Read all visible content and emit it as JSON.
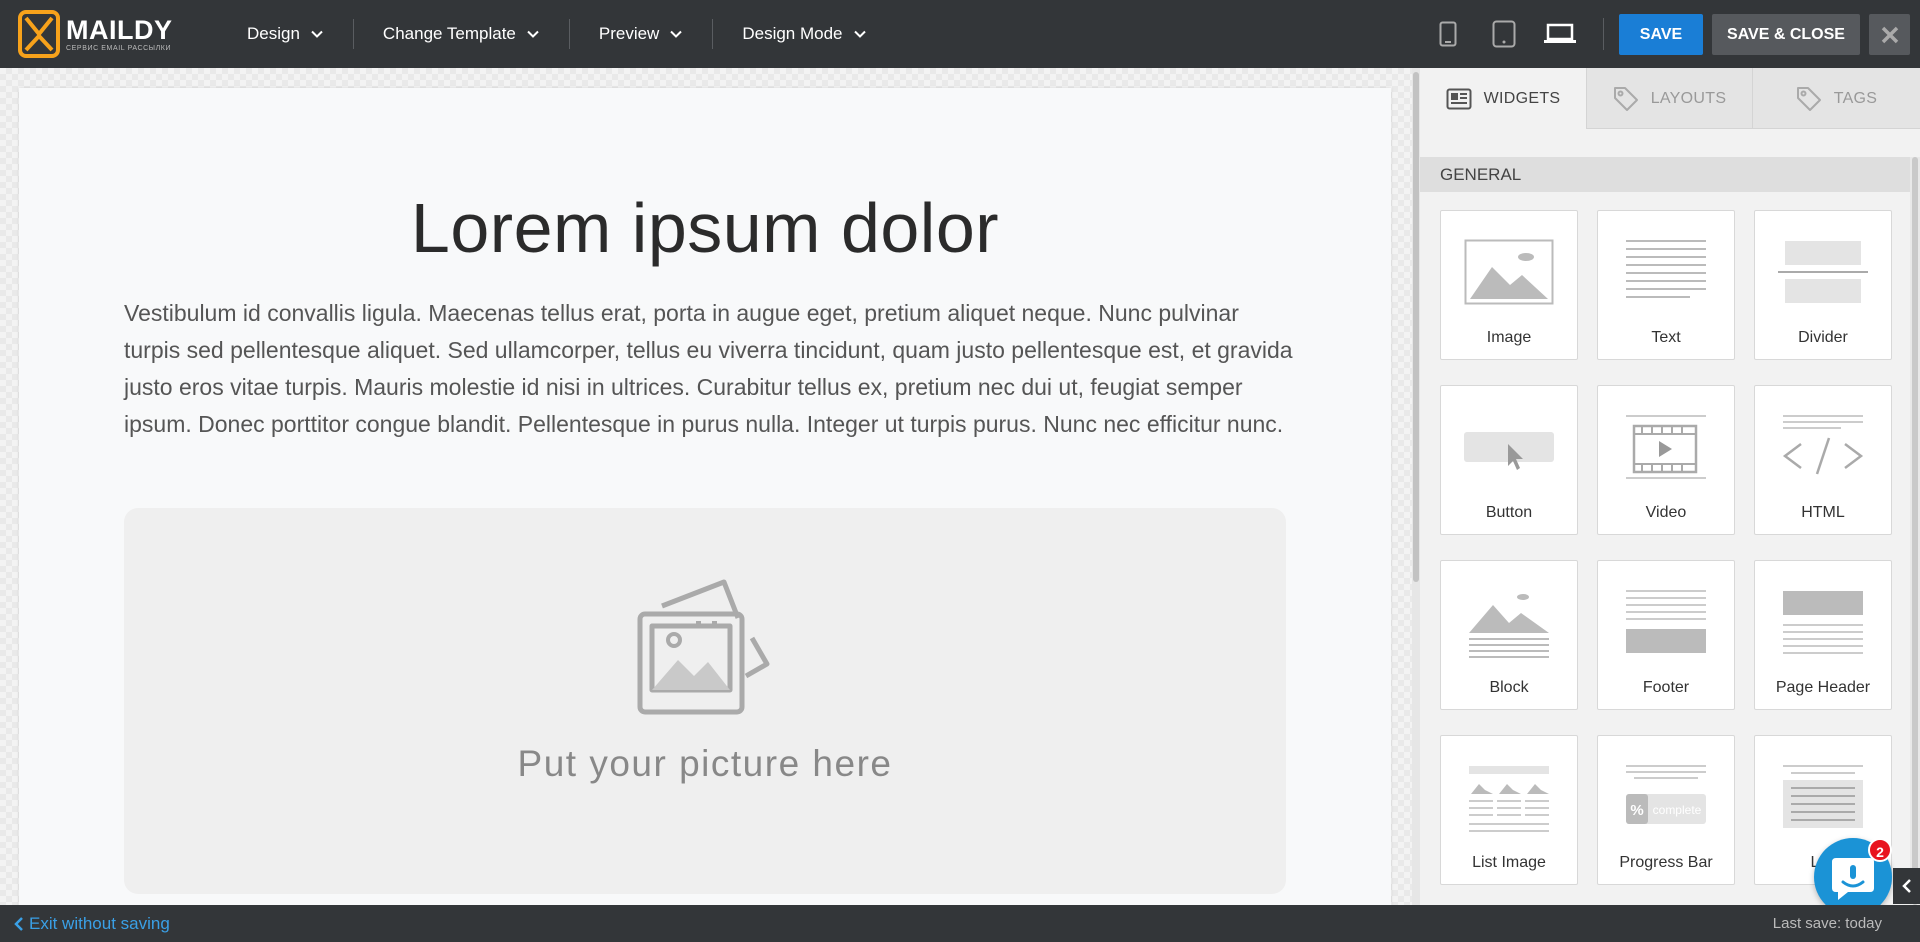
{
  "brand": {
    "name": "MAILDY",
    "tagline": "СЕРВИС EMAIL РАССЫЛКИ",
    "accent_color": "#f7a21b"
  },
  "menu": [
    {
      "label": "Design"
    },
    {
      "label": "Change Template"
    },
    {
      "label": "Preview"
    },
    {
      "label": "Design Mode"
    }
  ],
  "devices": {
    "mobile_icon": "phone-icon",
    "tablet_icon": "tablet-icon",
    "desktop_icon": "laptop-icon",
    "active": "desktop"
  },
  "actions": {
    "save_label": "SAVE",
    "save_close_label": "SAVE & CLOSE",
    "save_color": "#1a7ed6"
  },
  "email": {
    "heading": "Lorem ipsum dolor",
    "body": "Vestibulum id convallis ligula. Maecenas tellus erat, porta in augue eget, pretium aliquet neque. Nunc pulvinar turpis sed pellentesque aliquet. Sed ullamcorper, tellus eu viverra tincidunt, quam justo pellentesque est, et gravida justo eros vitae turpis. Mauris molestie id nisi in ultrices. Curabitur tellus ex, pretium nec dui ut, feugiat semper ipsum. Donec porttitor congue blandit. Pellentesque in purus nulla. Integer ut turpis purus. Nunc nec efficitur nunc.",
    "picture_placeholder": "Put your picture here"
  },
  "panel": {
    "tabs": [
      {
        "label": "WIDGETS",
        "icon": "widgets-icon",
        "active": true
      },
      {
        "label": "LAYOUTS",
        "icon": "tag-icon",
        "active": false
      },
      {
        "label": "TAGS",
        "icon": "tag-icon",
        "active": false
      }
    ],
    "section_title": "GENERAL",
    "widgets": [
      {
        "label": "Image",
        "icon": "image-widget-icon"
      },
      {
        "label": "Text",
        "icon": "text-widget-icon"
      },
      {
        "label": "Divider",
        "icon": "divider-widget-icon"
      },
      {
        "label": "Button",
        "icon": "button-widget-icon"
      },
      {
        "label": "Video",
        "icon": "video-widget-icon"
      },
      {
        "label": "HTML",
        "icon": "html-widget-icon"
      },
      {
        "label": "Block",
        "icon": "block-widget-icon"
      },
      {
        "label": "Footer",
        "icon": "footer-widget-icon"
      },
      {
        "label": "Page Header",
        "icon": "page-header-widget-icon"
      },
      {
        "label": "List Image",
        "icon": "list-image-widget-icon"
      },
      {
        "label": "Progress Bar",
        "icon": "progress-bar-widget-icon",
        "icon_text": "complete",
        "icon_symbol": "%"
      },
      {
        "label": "List",
        "icon": "list-widget-icon"
      }
    ]
  },
  "chat": {
    "badge_count": "2",
    "icon": "chat-icon",
    "color": "#1b93d6"
  },
  "footer": {
    "exit_label": "Exit without saving",
    "last_save": "Last save: today"
  }
}
